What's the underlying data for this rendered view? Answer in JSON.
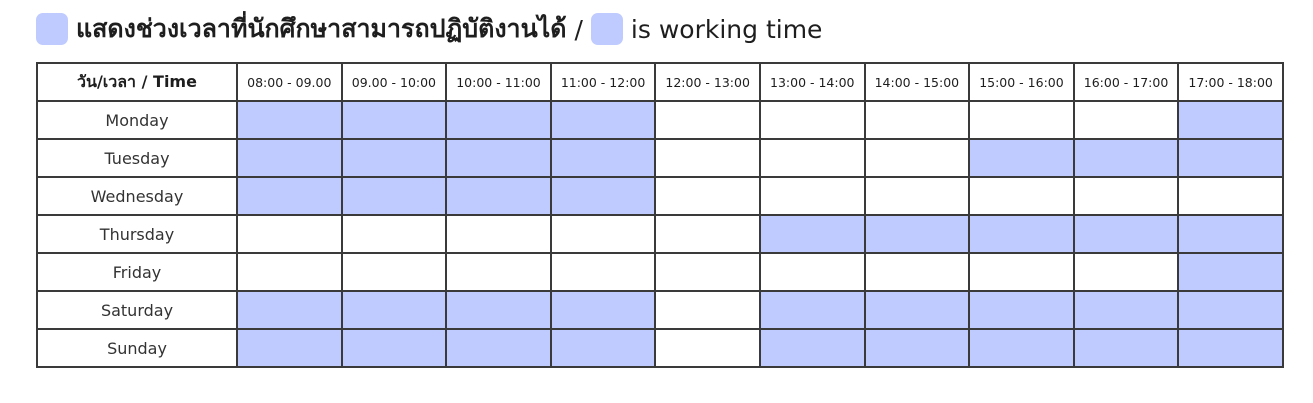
{
  "legend": {
    "thai_text": "แสดงช่วงเวลาที่นักศึกษาสามารถปฏิบัติงานได้",
    "separator": "/",
    "english_text": "is working time",
    "swatch_color": "#bfcbff"
  },
  "table": {
    "corner_header": "วัน/เวลา / Time",
    "time_slots": [
      "08:00 - 09.00",
      "09.00 - 10:00",
      "10:00 - 11:00",
      "11:00 - 12:00",
      "12:00 - 13:00",
      "13:00 - 14:00",
      "14:00 - 15:00",
      "15:00 - 16:00",
      "16:00 - 17:00",
      "17:00 - 18:00"
    ],
    "days": [
      {
        "name": "Monday",
        "working": [
          true,
          true,
          true,
          true,
          false,
          false,
          false,
          false,
          false,
          true
        ]
      },
      {
        "name": "Tuesday",
        "working": [
          true,
          true,
          true,
          true,
          false,
          false,
          false,
          true,
          true,
          true
        ]
      },
      {
        "name": "Wednesday",
        "working": [
          true,
          true,
          true,
          true,
          false,
          false,
          false,
          false,
          false,
          false
        ]
      },
      {
        "name": "Thursday",
        "working": [
          false,
          false,
          false,
          false,
          false,
          true,
          true,
          true,
          true,
          true
        ]
      },
      {
        "name": "Friday",
        "working": [
          false,
          false,
          false,
          false,
          false,
          false,
          false,
          false,
          false,
          true
        ]
      },
      {
        "name": "Saturday",
        "working": [
          true,
          true,
          true,
          true,
          false,
          true,
          true,
          true,
          true,
          true
        ]
      },
      {
        "name": "Sunday",
        "working": [
          true,
          true,
          true,
          true,
          false,
          true,
          true,
          true,
          true,
          true
        ]
      }
    ],
    "working_color": "#bfcbff",
    "free_color": "#ffffff"
  }
}
